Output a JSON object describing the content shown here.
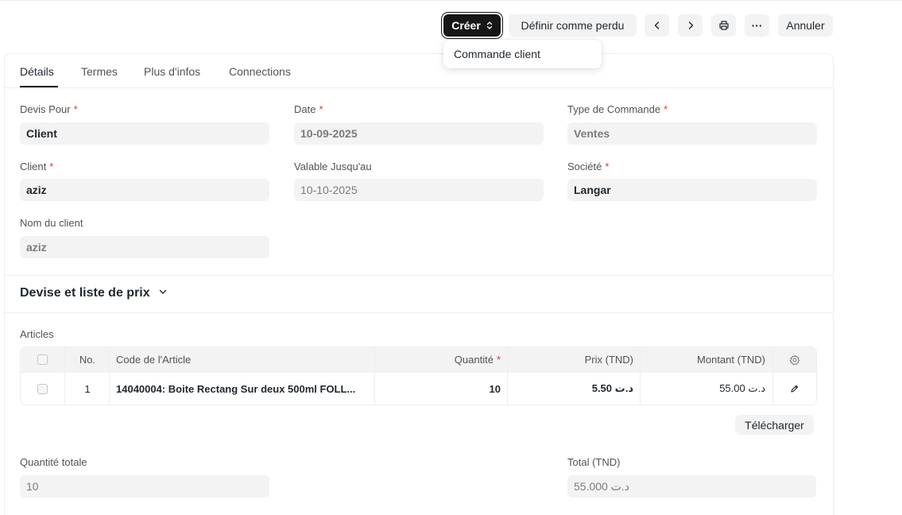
{
  "toolbar": {
    "create_label": "Créer",
    "lost_label": "Définir comme perdu",
    "more_label": "···",
    "cancel_label": "Annuler"
  },
  "create_menu": {
    "items": [
      {
        "label": "Commande client"
      }
    ]
  },
  "tabs": [
    {
      "label": "Détails",
      "active": true
    },
    {
      "label": "Termes",
      "active": false
    },
    {
      "label": "Plus d'infos",
      "active": false
    },
    {
      "label": "Connections",
      "active": false
    }
  ],
  "fields": {
    "quotation_to": {
      "label": "Devis Pour",
      "required": "*",
      "value": "Client"
    },
    "date": {
      "label": "Date",
      "required": "*",
      "value": "10-09-2025"
    },
    "order_type": {
      "label": "Type de Commande",
      "required": "*",
      "value": "Ventes"
    },
    "customer": {
      "label": "Client",
      "required": "*",
      "value": "aziz"
    },
    "valid_till": {
      "label": "Valable Jusqu'au",
      "value": "10-10-2025"
    },
    "company": {
      "label": "Société",
      "required": "*",
      "value": "Langar"
    },
    "customer_name": {
      "label": "Nom du client",
      "value": "aziz"
    }
  },
  "currency_section": {
    "title": "Devise et liste de prix"
  },
  "items_table": {
    "label": "Articles",
    "headers": {
      "no": "No.",
      "item_code": "Code de l'Article",
      "qty": "Quantité",
      "qty_required": "*",
      "rate": "Prix (TND)",
      "amount": "Montant (TND)"
    },
    "rows": [
      {
        "no": "1",
        "item_code": "14040004: Boite Rectang Sur deux 500ml FOLL...",
        "qty": "10",
        "rate": "5.50 د.ت",
        "amount": "55.00 د.ت"
      }
    ],
    "upload_label": "Télécharger"
  },
  "totals": {
    "total_qty": {
      "label": "Quantité totale",
      "value": "10"
    },
    "total": {
      "label": "Total (TND)",
      "value": "55.000 د.ت"
    }
  },
  "colors": {
    "primary": "#171717",
    "required": "#e03636",
    "field_bg": "#f3f3f3",
    "border": "#ebeef0"
  },
  "icons": [
    "chevron-up-down-icon",
    "chevron-left-icon",
    "chevron-right-icon",
    "printer-icon",
    "chevron-down-icon",
    "gear-icon",
    "pencil-icon"
  ]
}
